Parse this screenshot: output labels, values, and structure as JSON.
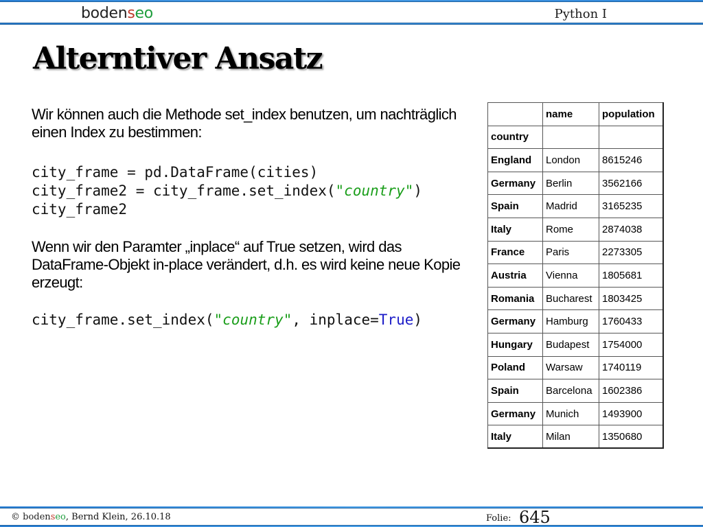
{
  "header": {
    "logo": {
      "part_a": "boden",
      "part_b": "s",
      "part_c": "eo"
    },
    "course_title": "Python I"
  },
  "slide": {
    "title": "Alterntiver Ansatz",
    "paragraph1": "Wir können auch die Methode set_index benutzen, um nachträglich einen Index zu bestimmen:",
    "code1": {
      "line1": "city_frame = pd.DataFrame(cities)",
      "line2_pre": "city_frame2 = city_frame.set_index(",
      "line2_quote_open": "\"",
      "line2_str": "country",
      "line2_quote_close": "\"",
      "line2_post": ")",
      "line3": "city_frame2"
    },
    "paragraph2": "Wenn wir den Paramter „inplace“ auf True setzen, wird das DataFrame-Objekt in-place verändert, d.h. es wird keine neue Kopie erzeugt:",
    "code2": {
      "pre": "city_frame.set_index(",
      "str": "\"country\"",
      "mid": ", inplace=",
      "kw": "True",
      "post": ")"
    }
  },
  "table": {
    "columns": [
      "",
      "name",
      "population"
    ],
    "index_name": "country",
    "rows": [
      {
        "country": "England",
        "name": "London",
        "population": "8615246"
      },
      {
        "country": "Germany",
        "name": "Berlin",
        "population": "3562166"
      },
      {
        "country": "Spain",
        "name": "Madrid",
        "population": "3165235"
      },
      {
        "country": "Italy",
        "name": "Rome",
        "population": "2874038"
      },
      {
        "country": "France",
        "name": "Paris",
        "population": "2273305"
      },
      {
        "country": "Austria",
        "name": "Vienna",
        "population": "1805681"
      },
      {
        "country": "Romania",
        "name": "Bucharest",
        "population": "1803425"
      },
      {
        "country": "Germany",
        "name": "Hamburg",
        "population": "1760433"
      },
      {
        "country": "Hungary",
        "name": "Budapest",
        "population": "1754000"
      },
      {
        "country": "Poland",
        "name": "Warsaw",
        "population": "1740119"
      },
      {
        "country": "Spain",
        "name": "Barcelona",
        "population": "1602386"
      },
      {
        "country": "Germany",
        "name": "Munich",
        "population": "1493900"
      },
      {
        "country": "Italy",
        "name": "Milan",
        "population": "1350680"
      }
    ]
  },
  "footer": {
    "copyright": "©",
    "brand": {
      "part_a": "boden",
      "part_b": "s",
      "part_c": "eo"
    },
    "author_date": ", Bernd Klein, 26.10.18",
    "slide_label": "Folie:",
    "slide_number": "645"
  },
  "colors": {
    "header_blue": "#2a7fd4",
    "code_string": "#1a9e1a",
    "code_keyword": "#1c1cc8",
    "logo_red": "#c0392b",
    "logo_green": "#1f9e3d"
  }
}
